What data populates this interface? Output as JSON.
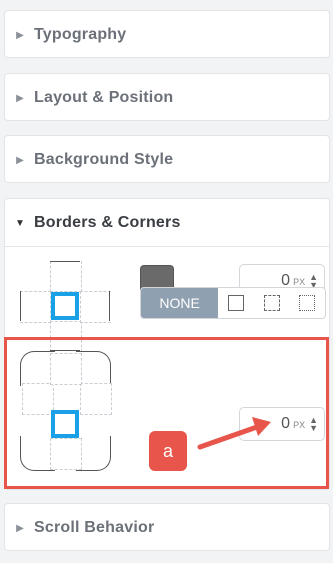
{
  "sections": [
    {
      "label": "Typography",
      "expanded": false
    },
    {
      "label": "Layout & Position",
      "expanded": false
    },
    {
      "label": "Background Style",
      "expanded": false
    },
    {
      "label": "Borders & Corners",
      "expanded": true
    },
    {
      "label": "Scroll Behavior",
      "expanded": false
    }
  ],
  "borders": {
    "color": "#6a6a6a",
    "width": {
      "value": "0",
      "unit": "PX"
    },
    "style_none_label": "NONE",
    "style_options": [
      "solid",
      "dashed",
      "dotted"
    ]
  },
  "corners": {
    "radius": {
      "value": "0",
      "unit": "PX"
    }
  },
  "annotation": {
    "label": "a",
    "color": "#e8564b"
  },
  "icons": {
    "collapsed": "caret-right-icon",
    "expanded": "caret-down-icon",
    "stepper": "stepper-arrows-icon"
  }
}
